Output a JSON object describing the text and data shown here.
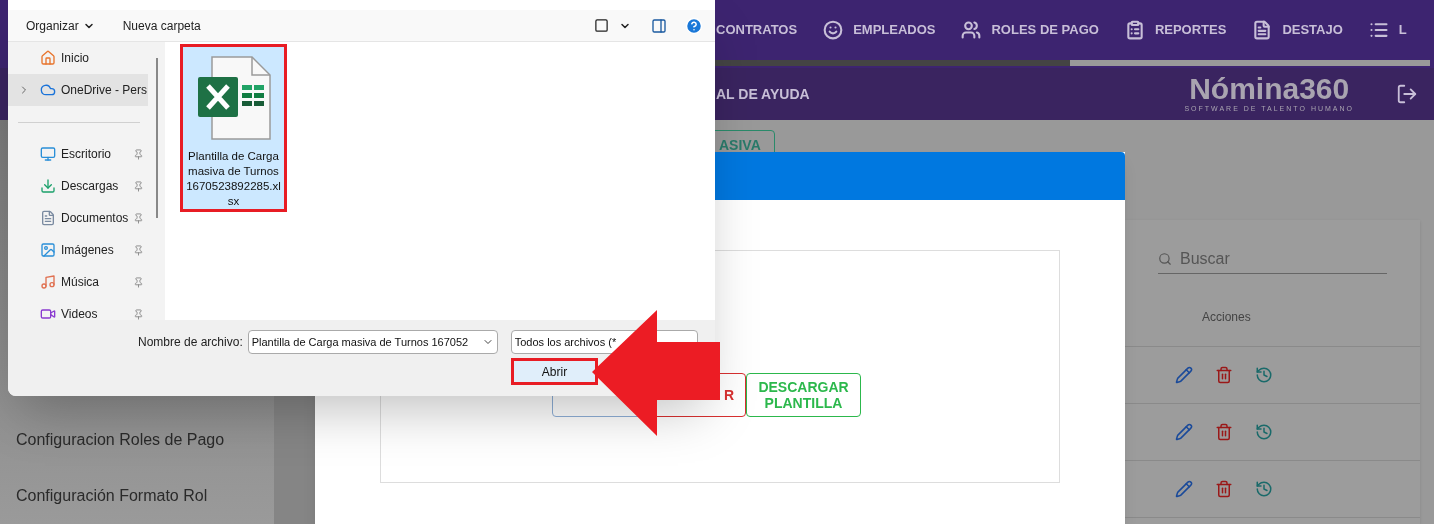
{
  "top_nav": {
    "items": [
      {
        "label": "CONTRATOS"
      },
      {
        "label": "EMPLEADOS"
      },
      {
        "label": "ROLES DE PAGO"
      },
      {
        "label": "REPORTES"
      },
      {
        "label": "DESTAJO"
      },
      {
        "label": "L"
      }
    ]
  },
  "sub_header": {
    "link": "AL DE AYUDA",
    "logo": "Nómina360",
    "tagline": "SOFTWARE DE TALENTO HUMANO"
  },
  "page_button": "ASIVA",
  "sidebar": {
    "items": [
      "Configuracion Roles de Pago",
      "Configuración Formato Rol"
    ]
  },
  "modal": {
    "buttons": [
      {
        "kind": "primary"
      },
      {
        "label": "R",
        "kind": "danger"
      },
      {
        "label": "DESCARGAR PLANTILLA",
        "kind": "success"
      }
    ]
  },
  "table": {
    "search_placeholder": "Buscar",
    "columns": [
      "Acciones"
    ]
  },
  "file_dialog": {
    "toolbar": {
      "organize": "Organizar",
      "new_folder": "Nueva carpeta"
    },
    "nav_sections": [
      {
        "items": [
          {
            "label": "Inicio",
            "selected": false,
            "pinned": false,
            "expandable": false
          },
          {
            "label": "OneDrive - Pers",
            "selected": true,
            "pinned": false,
            "expandable": true
          }
        ]
      },
      {
        "items": [
          {
            "label": "Escritorio",
            "selected": false,
            "pinned": true,
            "expandable": false
          },
          {
            "label": "Descargas",
            "selected": false,
            "pinned": true,
            "expandable": false
          },
          {
            "label": "Documentos",
            "selected": false,
            "pinned": true,
            "expandable": false
          },
          {
            "label": "Imágenes",
            "selected": false,
            "pinned": true,
            "expandable": false
          },
          {
            "label": "Música",
            "selected": false,
            "pinned": true,
            "expandable": false
          },
          {
            "label": "Videos",
            "selected": false,
            "pinned": true,
            "expandable": false
          }
        ]
      }
    ],
    "files": [
      {
        "name": "Plantilla de Carga masiva de Turnos 1670523892285.xlsx",
        "selected": true
      }
    ],
    "filename_label": "Nombre de archivo:",
    "filename_value": "Plantilla de Carga masiva de Turnos 167052",
    "filter": "Todos los archivos (*",
    "open_button": "Abrir"
  }
}
